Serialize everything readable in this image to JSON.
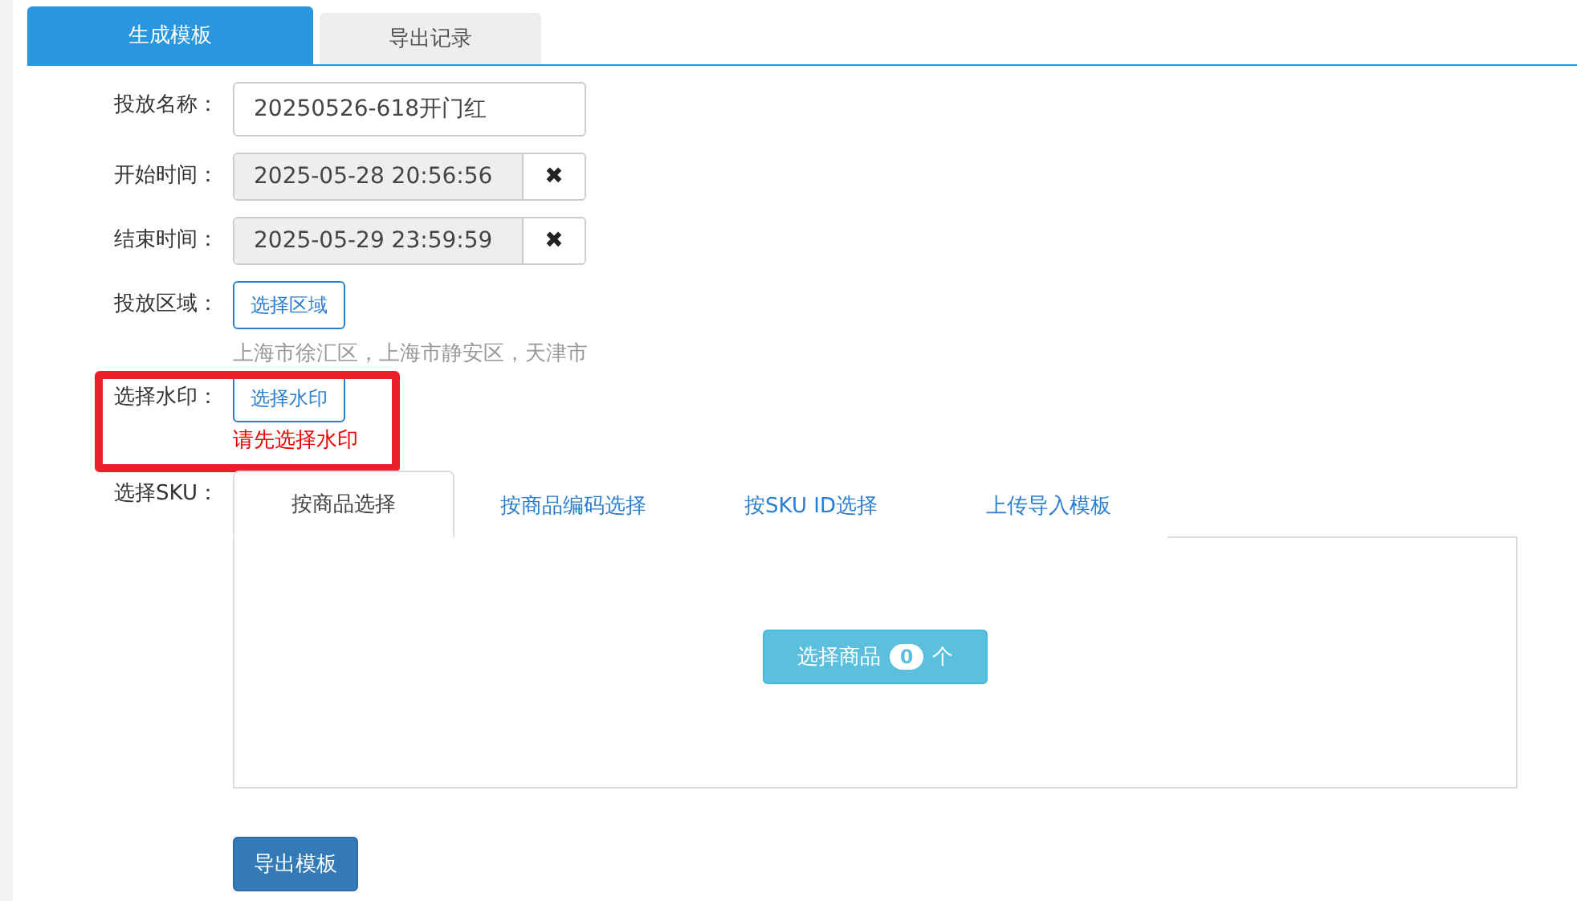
{
  "tabs": [
    {
      "label": "生成模板",
      "selected": true
    },
    {
      "label": "导出记录",
      "selected": false
    }
  ],
  "form": {
    "name": {
      "label": "投放名称：",
      "value": "20250526-618开门红"
    },
    "start": {
      "label": "开始时间：",
      "value": "2025-05-28 20:56:56",
      "clear": "✖"
    },
    "end": {
      "label": "结束时间：",
      "value": "2025-05-29 23:59:59",
      "clear": "✖"
    },
    "region": {
      "label": "投放区域：",
      "button": "选择区域",
      "summary": "上海市徐汇区，上海市静安区，天津市"
    },
    "watermark": {
      "label": "选择水印：",
      "button": "选择水印",
      "error": "请先选择水印",
      "highlighted": true
    },
    "sku": {
      "label": "选择SKU：",
      "tabs": [
        {
          "label": "按商品选择",
          "selected": true
        },
        {
          "label": "按商品编码选择",
          "selected": false
        },
        {
          "label": "按SKU ID选择",
          "selected": false
        },
        {
          "label": "上传导入模板",
          "selected": false
        }
      ],
      "select_button": {
        "label": "选择商品",
        "count": "0",
        "unit": "个"
      }
    }
  },
  "export_button": "导出模板"
}
